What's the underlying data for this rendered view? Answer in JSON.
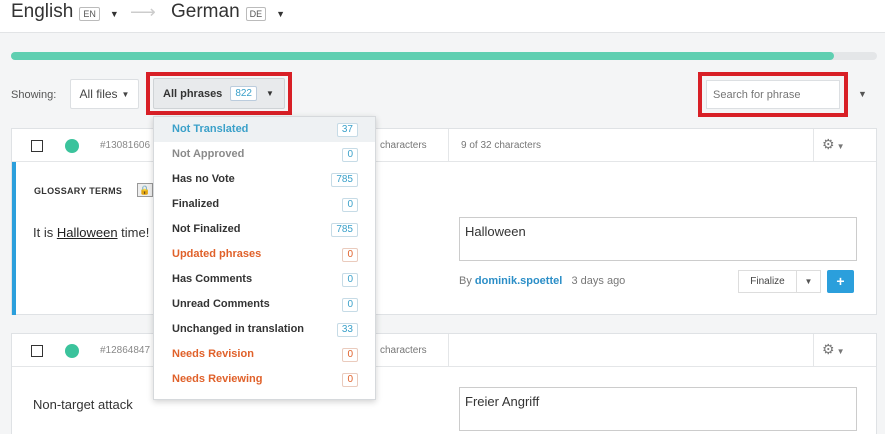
{
  "languages": {
    "source_name": "English",
    "source_code": "EN",
    "target_name": "German",
    "target_code": "DE"
  },
  "progress": {
    "fraction": 0.95,
    "color": "#5fcfb1"
  },
  "filters": {
    "showing_label": "Showing:",
    "files_label": "All files",
    "phrases_label": "All phrases",
    "phrases_count": "822",
    "search_placeholder": "Search for phrase"
  },
  "phrases": [
    {
      "id": "#13081606",
      "source_chars": "characters",
      "target_chars": "9 of 32 characters",
      "glossary_label": "GLOSSARY TERMS",
      "source_prefix": "It is ",
      "source_term": "Halloween",
      "source_suffix": " time!",
      "translation": "Halloween",
      "by_label": "By",
      "user": "dominik.spoettel",
      "time": "3 days ago",
      "finalize_label": "Finalize",
      "plus_label": "+"
    },
    {
      "id": "#12864847",
      "source_chars": "characters",
      "source_text": "Non-target attack",
      "translation": "Freier Angriff"
    }
  ],
  "dropdown": {
    "items": [
      {
        "label": "Not Translated",
        "count": "37",
        "style": "active"
      },
      {
        "label": "Not Approved",
        "count": "0",
        "style": "muted"
      },
      {
        "label": "Has no Vote",
        "count": "785",
        "style": ""
      },
      {
        "label": "Finalized",
        "count": "0",
        "style": ""
      },
      {
        "label": "Not Finalized",
        "count": "785",
        "style": ""
      },
      {
        "label": "Updated phrases",
        "count": "0",
        "style": "orange"
      },
      {
        "label": "Has Comments",
        "count": "0",
        "style": ""
      },
      {
        "label": "Unread Comments",
        "count": "0",
        "style": ""
      },
      {
        "label": "Unchanged in translation",
        "count": "33",
        "style": ""
      },
      {
        "label": "Needs Revision",
        "count": "0",
        "style": "orange"
      },
      {
        "label": "Needs Reviewing",
        "count": "0",
        "style": "orange"
      }
    ]
  },
  "colors": {
    "accent": "#2b9fdc",
    "highlight": "#d81f26",
    "warning": "#e0612a",
    "status_dot": "#3bc39c"
  }
}
